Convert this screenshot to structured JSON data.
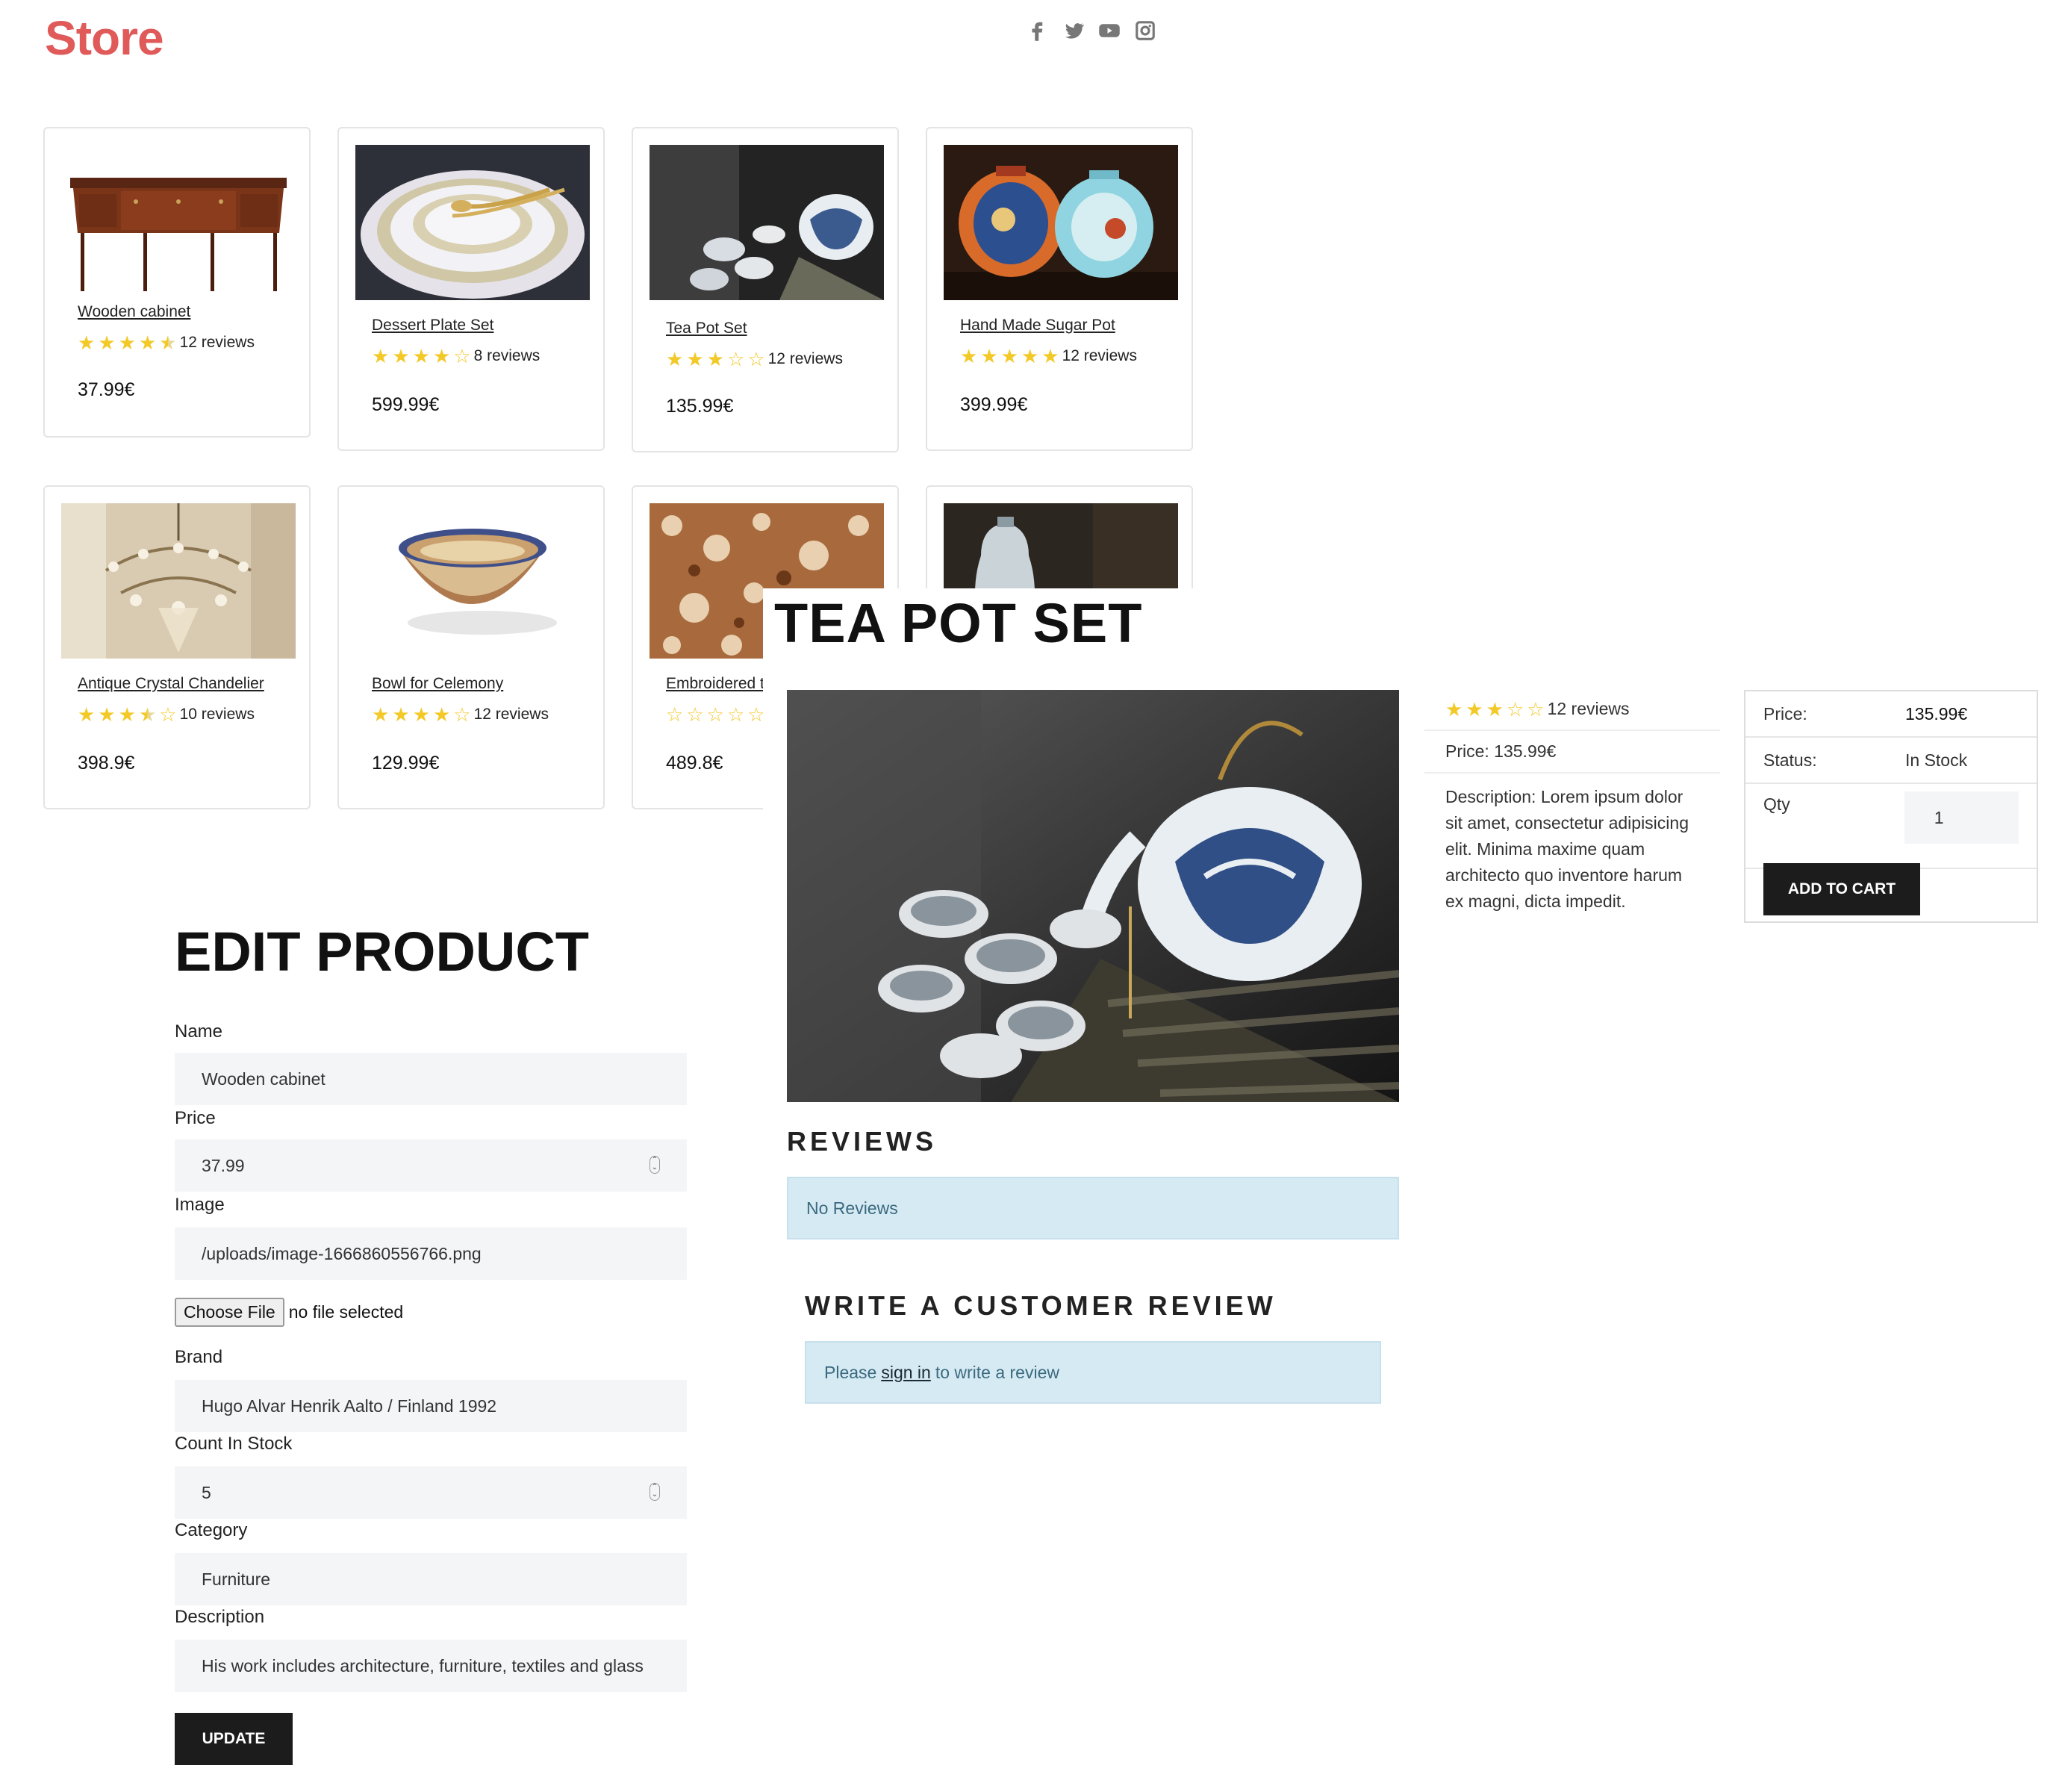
{
  "header": {
    "logo": "Store",
    "social": [
      "facebook-icon",
      "twitter-icon",
      "youtube-icon",
      "instagram-icon"
    ]
  },
  "products": [
    {
      "name": "Wooden cabinet",
      "rating": 4.5,
      "reviews": "12 reviews",
      "price": "37.99€"
    },
    {
      "name": "Dessert Plate Set",
      "rating": 4,
      "reviews": "8 reviews",
      "price": "599.99€"
    },
    {
      "name": "Tea Pot Set",
      "rating": 3,
      "reviews": "12 reviews",
      "price": "135.99€"
    },
    {
      "name": "Hand Made Sugar Pot",
      "rating": 5,
      "reviews": "12 reviews",
      "price": "399.99€"
    },
    {
      "name": "Antique Crystal Chandelier",
      "rating": 3.5,
      "reviews": "10 reviews",
      "price": "398.9€"
    },
    {
      "name": "Bowl for Celemony",
      "rating": 4,
      "reviews": "12 reviews",
      "price": "129.99€"
    },
    {
      "name": "Embroidered ta",
      "rating": 0,
      "reviews": "",
      "price": "489.8€"
    },
    {
      "name": "",
      "rating": 0,
      "reviews": "",
      "price": ""
    }
  ],
  "product_detail": {
    "title": "TEA POT SET",
    "rating": 3,
    "reviews": "12 reviews",
    "price_line": "Price: 135.99€",
    "description": "Description: Lorem ipsum dolor sit amet, consectetur adipisicing elit. Minima maxime quam architecto quo inventore harum ex magni, dicta impedit.",
    "buy_box": {
      "price_label": "Price:",
      "price_value": "135.99€",
      "status_label": "Status:",
      "status_value": "In Stock",
      "qty_label": "Qty",
      "qty_value": "1",
      "add_to_cart": "ADD TO CART"
    },
    "reviews_heading": "REVIEWS",
    "no_reviews": "No Reviews",
    "write_heading": "WRITE A CUSTOMER REVIEW",
    "signin_before": "Please",
    "signin_link": "sign in",
    "signin_after": "to write a review"
  },
  "edit_product": {
    "title": "EDIT PRODUCT",
    "name_label": "Name",
    "name_value": "Wooden cabinet",
    "price_label": "Price",
    "price_value": "37.99",
    "image_label": "Image",
    "image_value": "/uploads/image-1666860556766.png",
    "choose_file": "Choose File",
    "no_file": "no file selected",
    "brand_label": "Brand",
    "brand_value": "Hugo Alvar Henrik Aalto / Finland 1992",
    "count_label": "Count In Stock",
    "count_value": "5",
    "category_label": "Category",
    "category_value": "Furniture",
    "description_label": "Description",
    "description_value": "His work includes architecture, furniture, textiles and glass",
    "update": "UPDATE"
  }
}
